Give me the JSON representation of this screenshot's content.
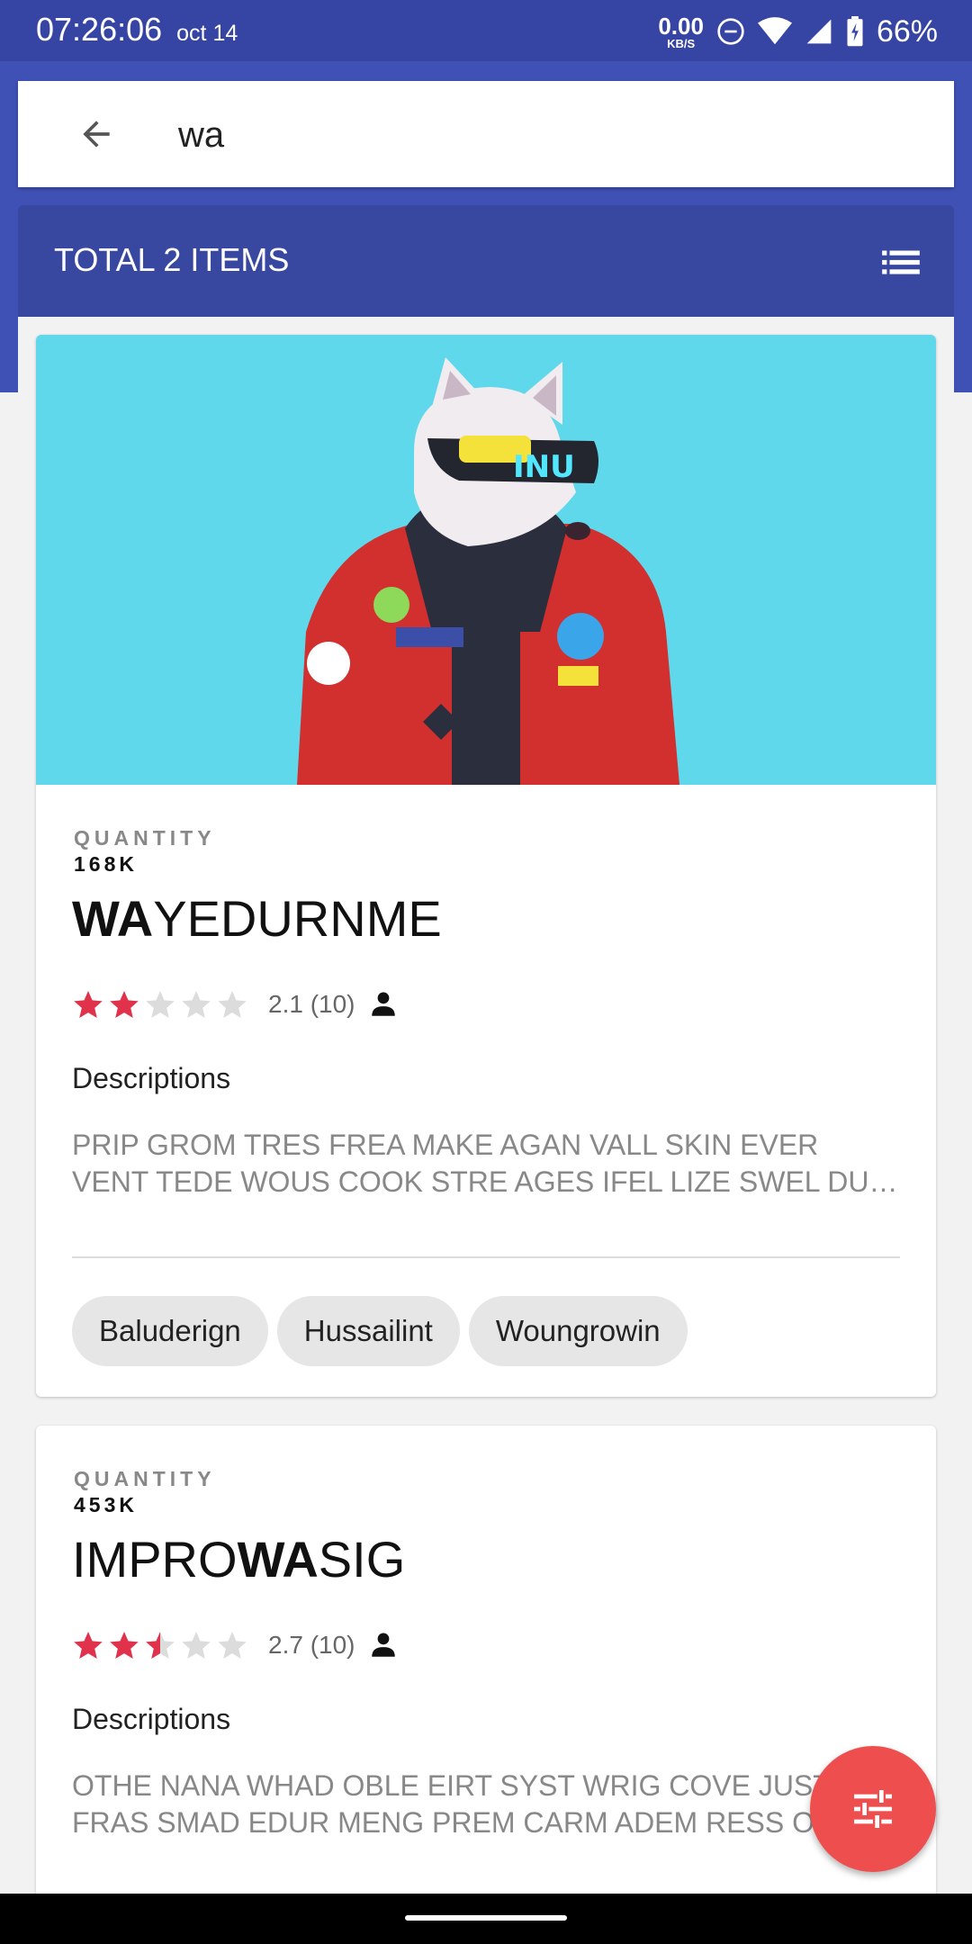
{
  "status_bar": {
    "time": "07:26:06",
    "date": "oct 14",
    "network_speed": "0.00",
    "network_unit": "KB/S",
    "battery": "66%"
  },
  "search": {
    "query": "wa",
    "back_icon": "arrow-back-icon"
  },
  "results_header": {
    "title": "TOTAL 2 ITEMS",
    "list_icon": "list-icon"
  },
  "items": [
    {
      "image": "cyberpunk-dog-in-red-jacket",
      "quantity_label": "QUANTITY",
      "quantity": "168K",
      "title_highlight": "WA",
      "title_rest": "YEDURNME",
      "rating": 2.1,
      "rating_text": "2.1 (10)",
      "descriptions_heading": "Descriptions",
      "description_line1": "PRIP GROM TRES FREA MAKE AGAN VALL SKIN EVER",
      "description_line2": "VENT TEDE WOUS COOK STRE AGES IFEL LIZE SWEL DUNS",
      "tags": [
        "Baluderign",
        "Hussailint",
        "Woungrowin"
      ]
    },
    {
      "quantity_label": "QUANTITY",
      "quantity": "453K",
      "title_before": "IMPRO",
      "title_highlight": "WA",
      "title_after": "SIG",
      "rating": 2.7,
      "rating_text": "2.7 (10)",
      "descriptions_heading": "Descriptions",
      "description_line1": "OTHE NANA WHAD OBLE EIRT SYST WRIG COVE JUST",
      "description_line2": "FRAS SMAD EDUR MENG PREM CARM ADEM RESS OVER"
    }
  ],
  "fab": {
    "icon": "tune-filter-icon"
  },
  "colors": {
    "status_bar": "#3644a4",
    "app_bar": "#3f51b5",
    "star": "#e0324a",
    "fab": "#ee4e4e"
  }
}
